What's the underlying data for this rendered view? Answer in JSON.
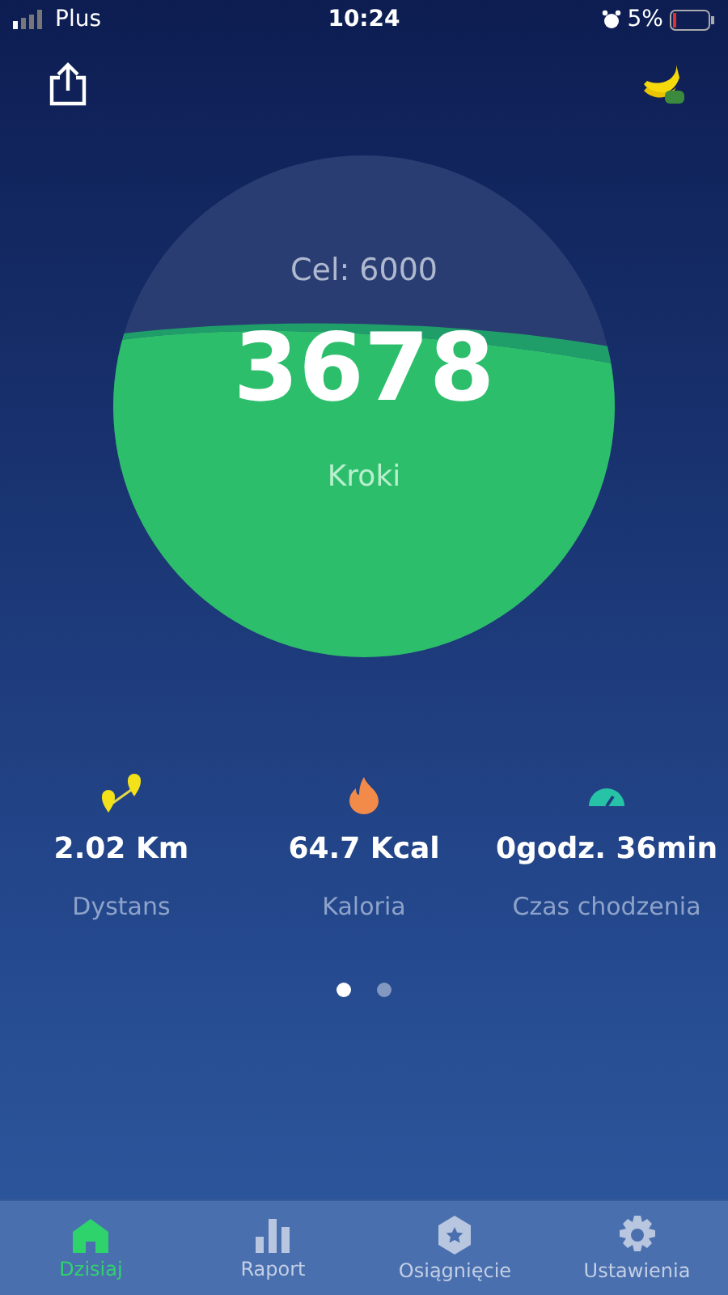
{
  "status_bar": {
    "carrier": "Plus",
    "time": "10:24",
    "battery": "5%"
  },
  "goal": {
    "label": "Cel: 6000",
    "steps": "3678",
    "unit": "Kroki"
  },
  "stats": [
    {
      "kind": "distance",
      "value": "2.02 Km",
      "label": "Dystans"
    },
    {
      "kind": "calories",
      "value": "64.7 Kcal",
      "label": "Kaloria"
    },
    {
      "kind": "time",
      "value": "0godz. 36min",
      "label": "Czas chodzenia"
    }
  ],
  "pages": [
    {
      "selected": true
    },
    {
      "selected": false
    }
  ],
  "tabs": [
    {
      "kind": "home",
      "label": "Dzisiaj",
      "selected": true
    },
    {
      "kind": "report",
      "label": "Raport",
      "selected": false
    },
    {
      "kind": "achievement",
      "label": "Osiągnięcie",
      "selected": false
    },
    {
      "kind": "settings",
      "label": "Ustawienia",
      "selected": false
    }
  ]
}
